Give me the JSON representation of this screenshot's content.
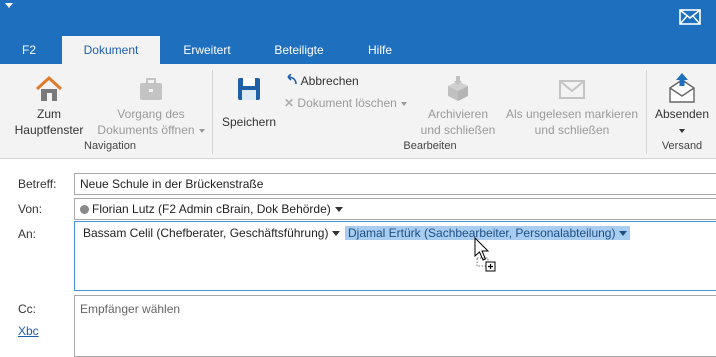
{
  "titlebar": {
    "quick_access_icon": "dropdown-arrow-icon",
    "mail_icon": "mail-icon"
  },
  "tabs": [
    {
      "label": "F2",
      "active": false
    },
    {
      "label": "Dokument",
      "active": true
    },
    {
      "label": "Erweitert",
      "active": false
    },
    {
      "label": "Beteiligte",
      "active": false
    },
    {
      "label": "Hilfe",
      "active": false
    }
  ],
  "ribbon": {
    "navigation": {
      "home_label_1": "Zum",
      "home_label_2": "Hauptfenster",
      "open_label_1": "Vorgang des",
      "open_label_2": "Dokuments öffnen",
      "group": "Navigation"
    },
    "bearbeiten": {
      "save_label": "Speichern",
      "cancel_label": "Abbrechen",
      "delete_label": "Dokument löschen",
      "archive_label_1": "Archivieren",
      "archive_label_2": "und schließen",
      "unread_label_1": "Als ungelesen markieren",
      "unread_label_2": "und schließen",
      "group": "Bearbeiten"
    },
    "versand": {
      "send_label": "Absenden",
      "group": "Versand"
    }
  },
  "form": {
    "subject_label": "Betreff:",
    "subject_value": "Neue Schule in der Brückenstraße",
    "from_label": "Von:",
    "from_value": "Florian Lutz (F2 Admin cBrain, Dok Behörde)",
    "to_label": "An:",
    "recipients": [
      {
        "name": "Bassam Celil (Chefberater, Geschäftsführung)",
        "selected": false
      },
      {
        "name": "Djamal Ertürk (Sachbearbeiter, Personalabteilung)",
        "selected": true
      }
    ],
    "cc_label": "Cc:",
    "bcc_link": "Xbc",
    "cc_placeholder": "Empfänger wählen"
  },
  "colors": {
    "accent": "#1f6fbf",
    "selection": "#a9cdf0"
  }
}
